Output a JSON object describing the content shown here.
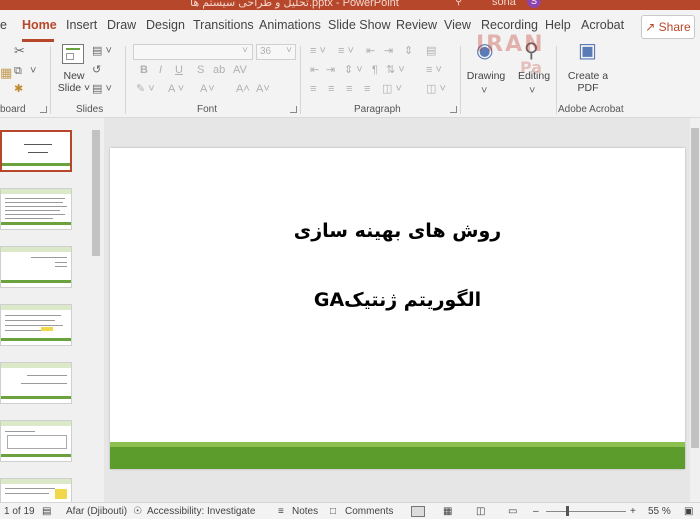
{
  "titlebar": {
    "document_title": "تحلیل و طراحی سیستم ها.pptx - PowerPoint",
    "user_name": "sona",
    "user_initial": "S"
  },
  "tabs": [
    "Home",
    "Insert",
    "Draw",
    "Design",
    "Transitions",
    "Animations",
    "Slide Show",
    "Review",
    "View",
    "Recording",
    "Help",
    "Acrobat"
  ],
  "share_label": "Share",
  "ribbon": {
    "groups": {
      "clipboard": "board",
      "slides": "Slides",
      "font": "Font",
      "paragraph": "Paragraph",
      "adobe": "Adobe Acrobat"
    },
    "new_slide_label": "New\nSlide",
    "font_size": "36",
    "drawing_label": "Drawing",
    "editing_label": "Editing",
    "create_pdf_label": "Create a PDF"
  },
  "watermark": {
    "line1": "IRAN",
    "line2": "Pa"
  },
  "slide": {
    "title": "روش های بهینه سازی",
    "subtitle": "الگوریتم ژنتیکGA"
  },
  "status": {
    "slide_counter": "1 of 19",
    "language": "Afar (Djibouti)",
    "accessibility": "Accessibility: Investigate",
    "notes": "Notes",
    "comments": "Comments",
    "zoom": "55 %"
  },
  "colors": {
    "accent": "#b7472a",
    "green": "#5c9c2c"
  }
}
